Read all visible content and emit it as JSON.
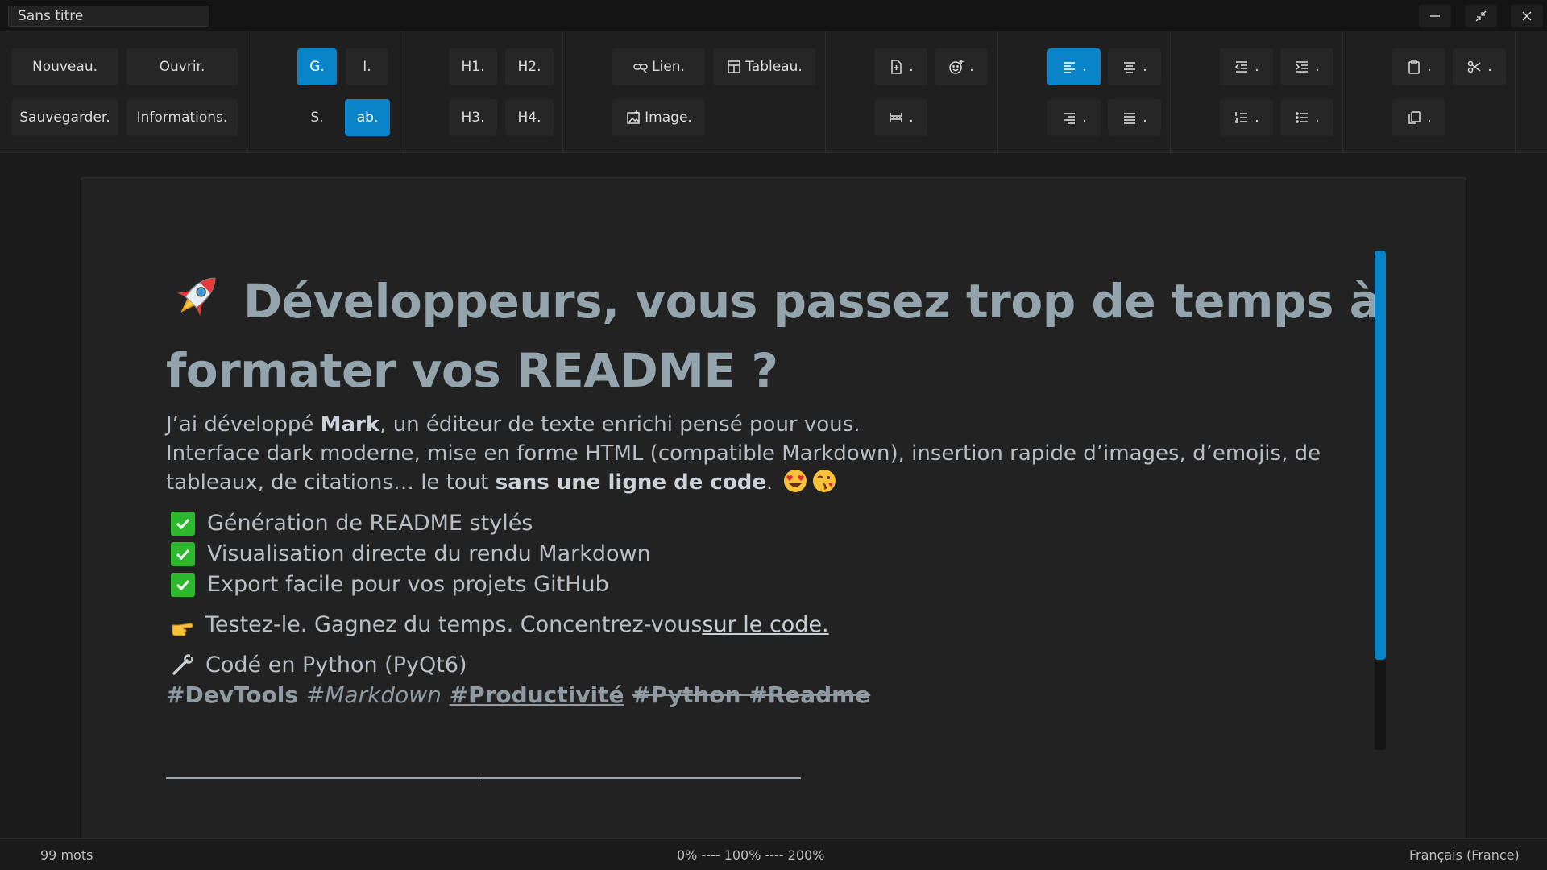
{
  "window": {
    "title": "Sans titre",
    "controls": [
      "minimize-icon",
      "restore-icon",
      "close-icon"
    ]
  },
  "toolbar": {
    "file": {
      "new": "Nouveau.",
      "open": "Ouvrir.",
      "save": "Sauvegarder.",
      "info": "Informations."
    },
    "format": {
      "bold": "G.",
      "italic": "I.",
      "strike": "S.",
      "underline": "ab."
    },
    "headings": {
      "h1": "H1.",
      "h2": "H2.",
      "h3": "H3.",
      "h4": "H4."
    },
    "insert": {
      "link": "Lien.",
      "table": "Tableau.",
      "image": "Image."
    },
    "dot": "."
  },
  "document": {
    "heading": "Développeurs, vous passez trop de temps à formater vos README ?",
    "intro_1": "J’ai développé ",
    "intro_bold": "Mark",
    "intro_2": ", un éditeur de texte enrichi pensé pour vous.",
    "intro_3": "Interface dark moderne, mise en forme HTML (compatible Markdown), insertion rapide d’images, d’emojis, de tableaux, de citations… le tout ",
    "intro_bold_2": "sans une ligne de code",
    "intro_4": ".",
    "checklist": [
      "Génération de README stylés",
      "Visualisation directe du rendu Markdown",
      "Export facile pour vos projets GitHub"
    ],
    "cta_text": "Testez-le. Gagnez du temps. Concentrez-vous",
    "cta_link": "sur le code.",
    "coded_in": "Codé en Python (PyQt6)",
    "tags": {
      "devtools": "#DevTools",
      "markdown": "#Markdown",
      "productivite": "#Productivité",
      "python_readme": "#Python #Readme"
    }
  },
  "status": {
    "word_count": "99 mots",
    "zoom": "0% ---- 100% ---- 200%",
    "language": "Français (France)"
  },
  "colors": {
    "accent": "#0a84c8",
    "heading": "#93a4ad",
    "check": "#2db82d"
  }
}
